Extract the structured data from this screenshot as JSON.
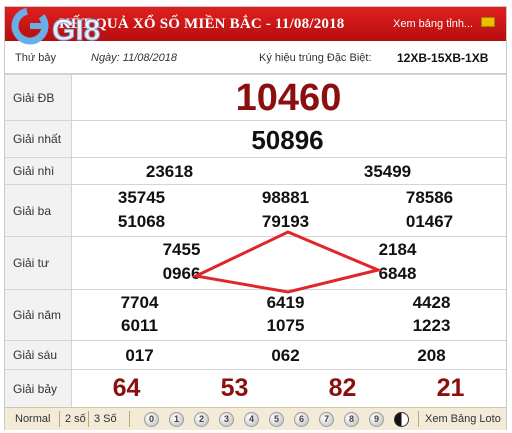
{
  "header": {
    "title": "KẾT QUẢ XỔ SỐ MIỀN BẮC - 11/08/2018",
    "view_link": "Xem bảng tỉnh..."
  },
  "watermark": {
    "text": "GI8"
  },
  "info": {
    "day": "Thứ bảy",
    "date": "Ngày: 11/08/2018",
    "symbol_label": "Ký hiệu trúng Đặc Biệt:",
    "symbol_value": "12XB-15XB-1XB"
  },
  "prizes": {
    "special": {
      "label": "Giải ĐB",
      "values": [
        "10460"
      ]
    },
    "first": {
      "label": "Giải nhất",
      "values": [
        "50896"
      ]
    },
    "second": {
      "label": "Giải nhì",
      "values": [
        "23618",
        "35499"
      ]
    },
    "third": {
      "label": "Giải ba",
      "values": [
        "35745",
        "98881",
        "78586",
        "51068",
        "79193",
        "01467"
      ]
    },
    "fourth": {
      "label": "Giải tư",
      "values": [
        "7455",
        "2184",
        "0966",
        "6848"
      ]
    },
    "fifth": {
      "label": "Giải năm",
      "values": [
        "7704",
        "6419",
        "4428",
        "6011",
        "1075",
        "1223"
      ]
    },
    "sixth": {
      "label": "Giải sáu",
      "values": [
        "017",
        "062",
        "208"
      ]
    },
    "seventh": {
      "label": "Giải bảy",
      "values": [
        "64",
        "53",
        "82",
        "21"
      ]
    }
  },
  "footer": {
    "normal": "Normal",
    "two_digits": "2 số",
    "three_digits": "3 Số",
    "digits": [
      "0",
      "1",
      "2",
      "3",
      "4",
      "5",
      "6",
      "7",
      "8",
      "9"
    ],
    "loto_link": "Xem Bảng Loto"
  },
  "colors": {
    "title_bar": "#c8161a",
    "prize_red": "#8b0f0f",
    "annotation": "#e0262b",
    "footer_bg": "#f3ead7"
  }
}
